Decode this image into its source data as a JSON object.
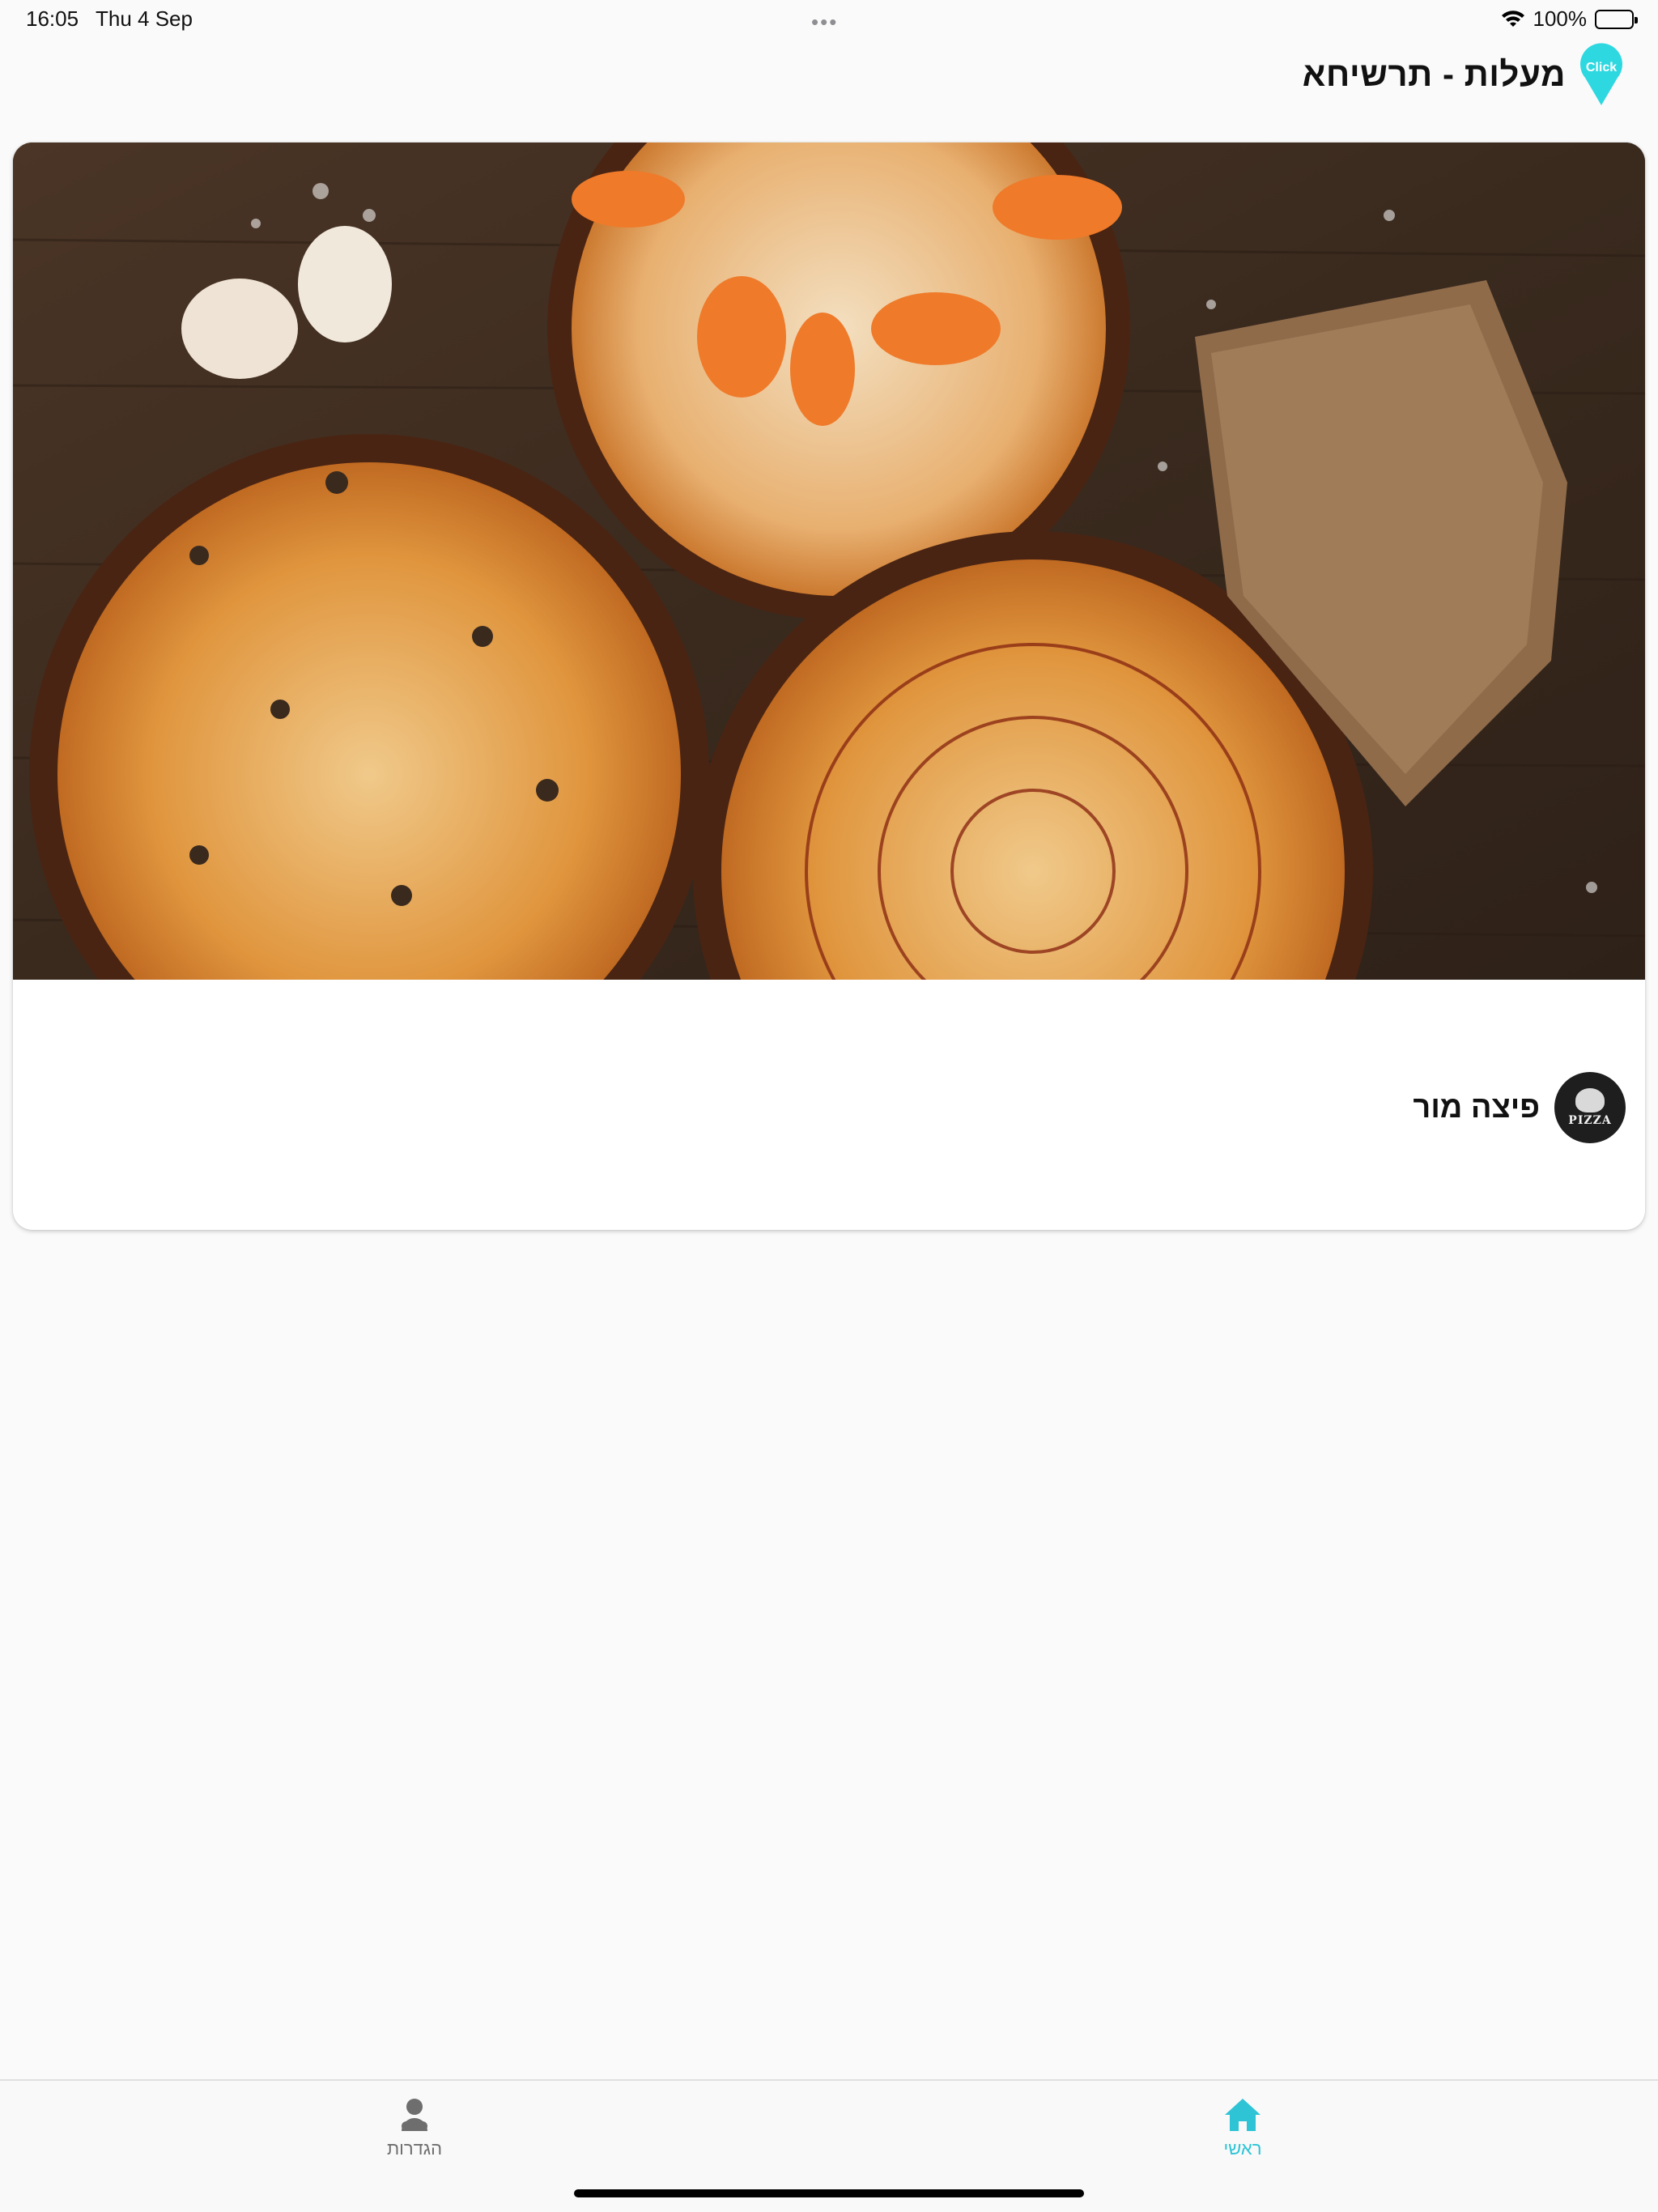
{
  "status_bar": {
    "time": "16:05",
    "date": "Thu 4 Sep",
    "battery": "100%",
    "battery_level": 1.0
  },
  "header": {
    "title": "מעלות - תרשיחא",
    "logo_text": "Click",
    "logo_color": "#2ed8e0"
  },
  "store": {
    "name": "פיצה מור",
    "avatar_text": "PIZZA"
  },
  "tabbar": {
    "settings_label": "הגדרות",
    "home_label": "ראשי",
    "active_color": "#2ec4d6",
    "inactive_color": "#6e6e6e"
  }
}
